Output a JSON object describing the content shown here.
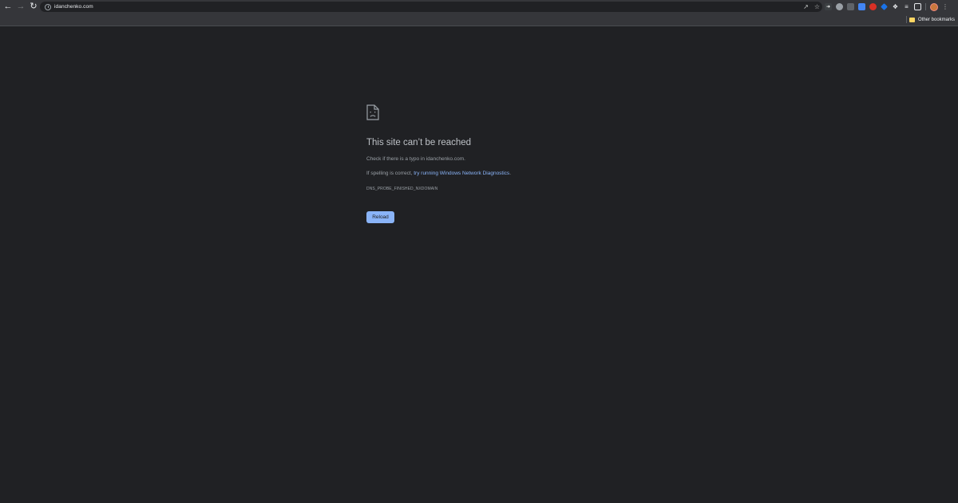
{
  "browser": {
    "url": "idanchenko.com",
    "bookmarks": {
      "other_label": "Other bookmarks"
    }
  },
  "error_page": {
    "title": "This site can’t be reached",
    "message_typo": "Check if there is a typo in idanchenko.com.",
    "spelling_prefix": "If spelling is correct, ",
    "diagnostics_link": "try running Windows Network Diagnostics",
    "spelling_suffix": ".",
    "error_code": "DNS_PROBE_FINISHED_NXDOMAIN",
    "reload_label": "Reload"
  },
  "icons": {
    "back": "back-arrow-icon",
    "forward": "forward-arrow-icon",
    "reload": "reload-icon",
    "site_info": "info-icon",
    "share": "share-icon",
    "bookmark_star": "star-icon",
    "extensions": "puzzle-icon",
    "menu": "kebab-menu-icon",
    "error": "sad-page-icon"
  },
  "colors": {
    "page_background": "#202124",
    "toolbar": "#35363a",
    "link": "#8ab4f8",
    "button": "#8ab4f8"
  }
}
